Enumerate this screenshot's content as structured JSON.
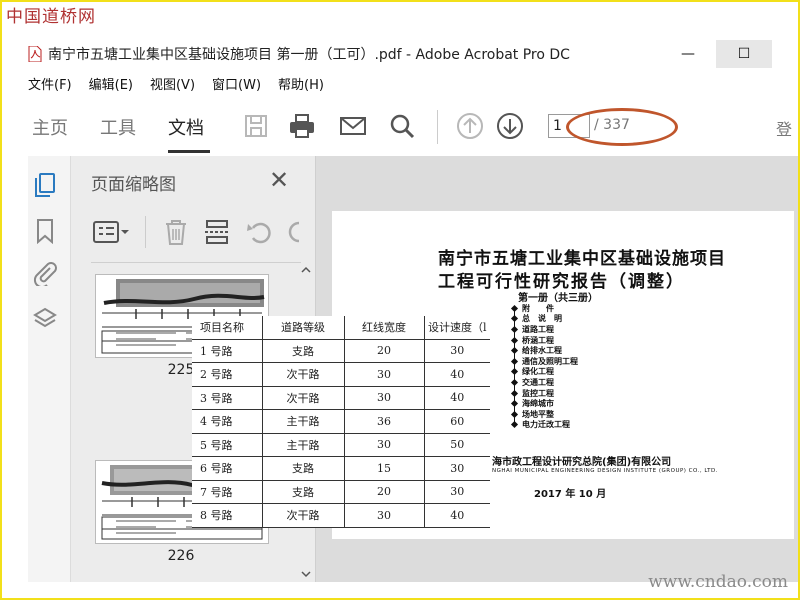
{
  "watermark": {
    "top": "中国道桥网",
    "bottom": "www.cndao.com"
  },
  "window": {
    "title": "南宁市五塘工业集中区基础设施项目 第一册（工可）.pdf - Adobe Acrobat Pro DC",
    "minimize": "—",
    "maximize": "☐"
  },
  "menu": {
    "items": [
      "文件(F)",
      "编辑(E)",
      "视图(V)",
      "窗口(W)",
      "帮助(H)"
    ]
  },
  "toolbar": {
    "tabs": {
      "home": "主页",
      "tools": "工具",
      "document": "文档"
    },
    "page_current": "1",
    "page_total": "/ 337",
    "sign_in": "登"
  },
  "panel": {
    "title": "页面缩略图",
    "close": "✕",
    "thumbnails": [
      {
        "label": "225"
      },
      {
        "label": "226"
      }
    ]
  },
  "document": {
    "title_line1": "南宁市五塘工业集中区基础设施项目",
    "title_line2": "工程可行性研究报告（调整）",
    "volume": "第一册（共三册）",
    "toc": [
      "附　　件",
      "总　说　明",
      "道路工程",
      "桥涵工程",
      "给排水工程",
      "通信及照明工程",
      "绿化工程",
      "交通工程",
      "监控工程",
      "海绵城市",
      "场地平整",
      "电力迁改工程"
    ],
    "company": "海市政工程设计研究总院(集团)有限公司",
    "company_en": "NGHAI MUNICIPAL ENGINEERING DESIGN INSTITUTE (GROUP) CO., LTD.",
    "date": "2017 年 10 月"
  },
  "table": {
    "headers": [
      "项目名称",
      "道路等级",
      "红线宽度",
      "设计速度（l"
    ],
    "rows": [
      [
        "1 号路",
        "支路",
        "20",
        "30"
      ],
      [
        "2 号路",
        "次干路",
        "30",
        "40"
      ],
      [
        "3 号路",
        "次干路",
        "30",
        "40"
      ],
      [
        "4 号路",
        "主干路",
        "36",
        "60"
      ],
      [
        "5 号路",
        "主干路",
        "30",
        "50"
      ],
      [
        "6 号路",
        "支路",
        "15",
        "30"
      ],
      [
        "7 号路",
        "支路",
        "20",
        "30"
      ],
      [
        "8 号路",
        "次干路",
        "30",
        "40"
      ]
    ]
  },
  "colors": {
    "annotation": "#c0562c",
    "frame": "#f2e01a",
    "watermark_top": "#b03232"
  }
}
